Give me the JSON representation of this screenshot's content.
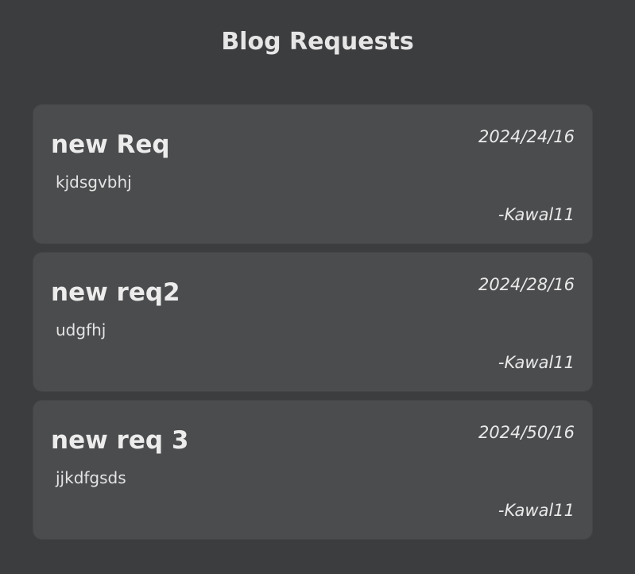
{
  "page": {
    "title": "Blog Requests"
  },
  "requests": [
    {
      "title": "new Req",
      "date": "2024/24/16",
      "body": "kjdsgvbhj",
      "author": "-Kawal11"
    },
    {
      "title": "new req2",
      "date": "2024/28/16",
      "body": "udgfhj",
      "author": "-Kawal11"
    },
    {
      "title": "new req 3",
      "date": "2024/50/16",
      "body": "jjkdfgsds",
      "author": "-Kawal11"
    }
  ],
  "colors": {
    "background": "#3c3d3f",
    "card": "#4b4c4e",
    "text": "#e9e9e9"
  }
}
